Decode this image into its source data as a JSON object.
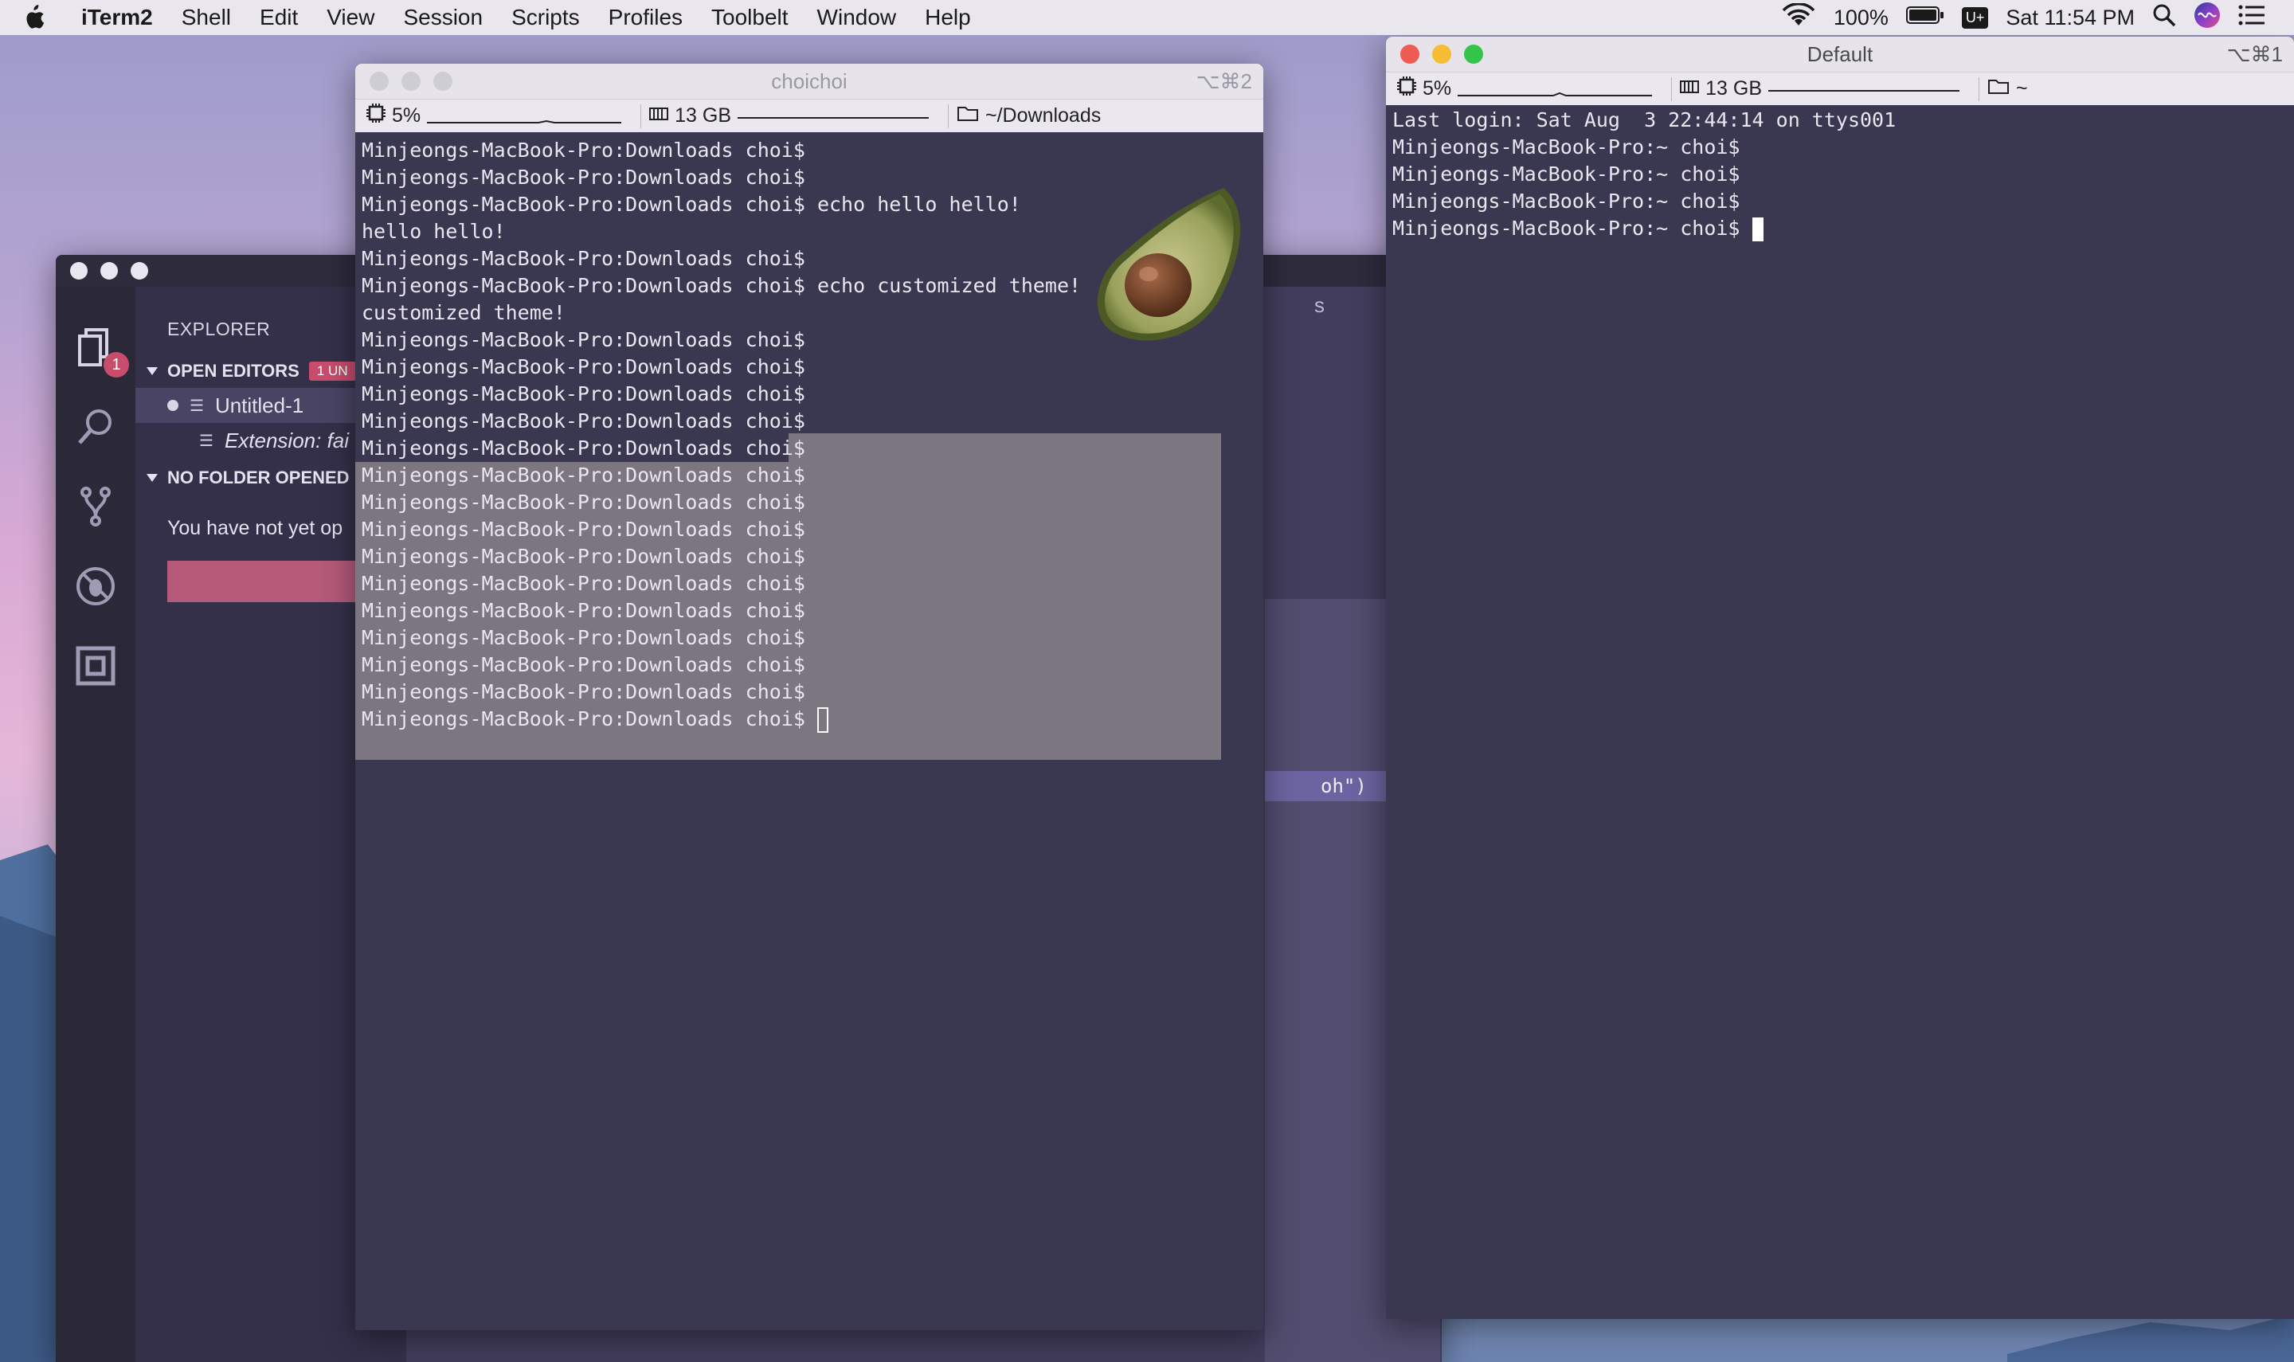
{
  "menubar": {
    "app": "iTerm2",
    "items": [
      "Shell",
      "Edit",
      "View",
      "Session",
      "Scripts",
      "Profiles",
      "Toolbelt",
      "Window",
      "Help"
    ],
    "battery": "100%",
    "input_source": "U+",
    "clock": "Sat 11:54 PM"
  },
  "vscode": {
    "explorer_title": "EXPLORER",
    "open_editors": "OPEN EDITORS",
    "unsaved_badge": "1 UN",
    "files": [
      "Untitled-1",
      "Extension: fai"
    ],
    "no_folder": "NO FOLDER OPENED",
    "message": "You have not yet op",
    "activity_badge": "1",
    "editor_fragment": "oh\")",
    "tab_fragment": "s"
  },
  "term1": {
    "title": "choichoi",
    "shortcut": "⌥⌘2",
    "cpu": "5%",
    "memory": "13 GB",
    "path": "~/Downloads",
    "lines": [
      "Minjeongs-MacBook-Pro:Downloads choi$",
      "Minjeongs-MacBook-Pro:Downloads choi$",
      "Minjeongs-MacBook-Pro:Downloads choi$ echo hello hello!",
      "hello hello!",
      "Minjeongs-MacBook-Pro:Downloads choi$",
      "Minjeongs-MacBook-Pro:Downloads choi$ echo customized theme!",
      "customized theme!",
      "Minjeongs-MacBook-Pro:Downloads choi$",
      "Minjeongs-MacBook-Pro:Downloads choi$",
      "Minjeongs-MacBook-Pro:Downloads choi$",
      "Minjeongs-MacBook-Pro:Downloads choi$",
      "Minjeongs-MacBook-Pro:Downloads choi$",
      "Minjeongs-MacBook-Pro:Downloads choi$",
      "Minjeongs-MacBook-Pro:Downloads choi$",
      "Minjeongs-MacBook-Pro:Downloads choi$",
      "Minjeongs-MacBook-Pro:Downloads choi$",
      "Minjeongs-MacBook-Pro:Downloads choi$",
      "Minjeongs-MacBook-Pro:Downloads choi$",
      "Minjeongs-MacBook-Pro:Downloads choi$",
      "Minjeongs-MacBook-Pro:Downloads choi$",
      "Minjeongs-MacBook-Pro:Downloads choi$",
      "Minjeongs-MacBook-Pro:Downloads choi$"
    ]
  },
  "term2": {
    "title": "Default",
    "shortcut": "⌥⌘1",
    "cpu": "5%",
    "memory": "13 GB",
    "path": "~",
    "lines": [
      "Last login: Sat Aug  3 22:44:14 on ttys001",
      "Minjeongs-MacBook-Pro:~ choi$",
      "Minjeongs-MacBook-Pro:~ choi$",
      "Minjeongs-MacBook-Pro:~ choi$",
      "Minjeongs-MacBook-Pro:~ choi$"
    ]
  },
  "colors": {
    "terminal_bg": "#3a3850",
    "selection": "#7b7680",
    "accent": "#c84d6d"
  }
}
